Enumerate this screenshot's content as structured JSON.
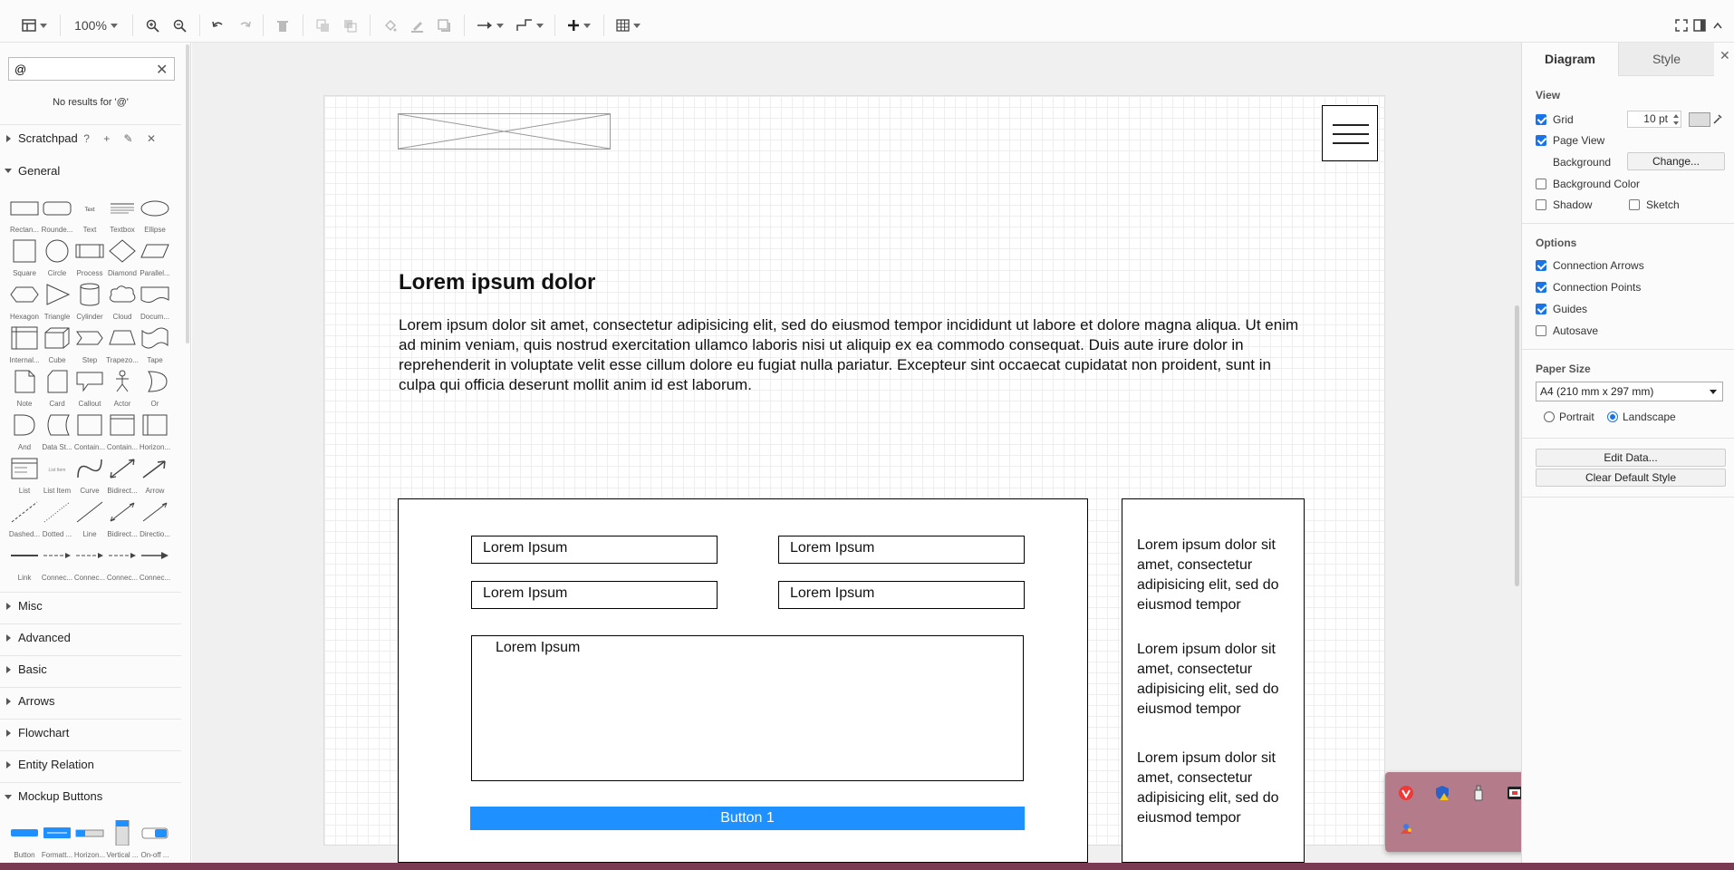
{
  "toolbar": {
    "zoom": "100%"
  },
  "search": {
    "value": "@",
    "no_results": "No results for '@'"
  },
  "sections": {
    "scratchpad": "Scratchpad",
    "scratchpad_tools": "? + ✎ ✕",
    "general": "General",
    "misc": "Misc",
    "advanced": "Advanced",
    "basic": "Basic",
    "arrows": "Arrows",
    "flowchart": "Flowchart",
    "entity_relation": "Entity Relation",
    "mockup_buttons": "Mockup Buttons"
  },
  "shapes": [
    {
      "label": "Rectan..."
    },
    {
      "label": "Rounde..."
    },
    {
      "label": "Text"
    },
    {
      "label": "Textbox"
    },
    {
      "label": "Ellipse"
    },
    {
      "label": "Square"
    },
    {
      "label": "Circle"
    },
    {
      "label": "Process"
    },
    {
      "label": "Diamond"
    },
    {
      "label": "Parallel..."
    },
    {
      "label": "Hexagon"
    },
    {
      "label": "Triangle"
    },
    {
      "label": "Cylinder"
    },
    {
      "label": "Cloud"
    },
    {
      "label": "Docum..."
    },
    {
      "label": "Internal..."
    },
    {
      "label": "Cube"
    },
    {
      "label": "Step"
    },
    {
      "label": "Trapezo..."
    },
    {
      "label": "Tape"
    },
    {
      "label": "Note"
    },
    {
      "label": "Card"
    },
    {
      "label": "Callout"
    },
    {
      "label": "Actor"
    },
    {
      "label": "Or"
    },
    {
      "label": "And"
    },
    {
      "label": "Data St..."
    },
    {
      "label": "Contain..."
    },
    {
      "label": "Contain..."
    },
    {
      "label": "Horizon..."
    },
    {
      "label": "List"
    },
    {
      "label": "List Item"
    },
    {
      "label": "Curve"
    },
    {
      "label": "Bidirect..."
    },
    {
      "label": "Arrow"
    },
    {
      "label": "Dashed..."
    },
    {
      "label": "Dotted ..."
    },
    {
      "label": "Line"
    },
    {
      "label": "Bidirect..."
    },
    {
      "label": "Directio..."
    },
    {
      "label": "Link"
    },
    {
      "label": "Connec..."
    },
    {
      "label": "Connec..."
    },
    {
      "label": "Connec..."
    },
    {
      "label": "Connec..."
    }
  ],
  "mockup_button_shapes": [
    {
      "label": "Button"
    },
    {
      "label": "Formatt..."
    },
    {
      "label": "Horizon..."
    },
    {
      "label": "Vertical ..."
    },
    {
      "label": "On-off ..."
    }
  ],
  "mockup": {
    "title": "Lorem ipsum dolor",
    "paragraph": "Lorem ipsum dolor sit amet, consectetur adipisicing elit, sed do eiusmod tempor incididunt ut labore et dolore magna aliqua. Ut enim ad minim veniam, quis nostrud exercitation ullamco laboris nisi ut aliquip ex ea commodo consequat. Duis aute irure dolor in reprehenderit in voluptate velit esse cillum dolore eu fugiat nulla pariatur. Excepteur sint occaecat cupidatat non proident, sunt in culpa qui officia deserunt mollit anim id est laborum.",
    "field1": "Lorem Ipsum",
    "field2": "Lorem Ipsum",
    "field3": "Lorem Ipsum",
    "field4": "Lorem Ipsum",
    "textarea": "Lorem Ipsum",
    "button": "Button 1",
    "side1": "Lorem ipsum dolor sit amet, consectetur adipisicing elit, sed do eiusmod tempor",
    "side2": "Lorem ipsum dolor sit amet, consectetur adipisicing elit, sed do eiusmod tempor",
    "side3": "Lorem ipsum dolor sit amet, consectetur adipisicing elit, sed do eiusmod tempor"
  },
  "format_panel": {
    "tab_diagram": "Diagram",
    "tab_style": "Style",
    "view_heading": "View",
    "grid": "Grid",
    "grid_size": "10 pt",
    "page_view": "Page View",
    "background": "Background",
    "change": "Change...",
    "background_color": "Background Color",
    "shadow": "Shadow",
    "sketch": "Sketch",
    "options_heading": "Options",
    "connection_arrows": "Connection Arrows",
    "connection_points": "Connection Points",
    "guides": "Guides",
    "autosave": "Autosave",
    "paper_heading": "Paper Size",
    "paper_size": "A4 (210 mm x 297 mm)",
    "portrait": "Portrait",
    "landscape": "Landscape",
    "edit_data": "Edit Data...",
    "clear_default_style": "Clear Default Style",
    "checked": {
      "grid": true,
      "page_view": true,
      "background_color": false,
      "shadow": false,
      "sketch": false,
      "connection_arrows": true,
      "connection_points": true,
      "guides": true,
      "autosave": false
    },
    "orientation": "landscape"
  },
  "colors": {
    "accent": "#1a73e8",
    "mock_button": "#1e90ff",
    "tray": "#b47c8a"
  },
  "tray_icons": [
    "vivaldi-icon",
    "shield-warning-icon",
    "usb-drive-icon",
    "remote-desktop-icon",
    "gpu-icon",
    "paint-icon"
  ]
}
